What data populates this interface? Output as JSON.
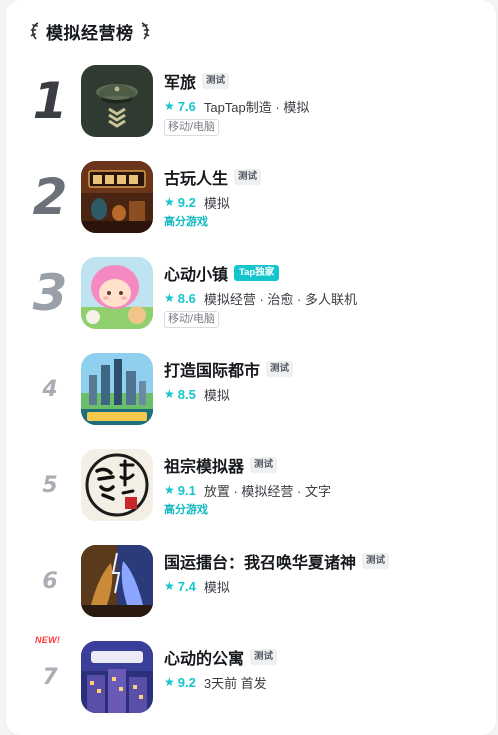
{
  "ranking": {
    "title": "模拟经营榜",
    "items": [
      {
        "rank": "1",
        "name": "军旅",
        "tag": "测试",
        "score": "7.6",
        "categories": "TapTap制造 · 模拟",
        "badge": "移动/电脑",
        "icon": "military-cap-icon"
      },
      {
        "rank": "2",
        "name": "古玩人生",
        "tag": "测试",
        "score": "9.2",
        "categories": "模拟",
        "badge": "高分游戏",
        "icon": "antique-shop-icon"
      },
      {
        "rank": "3",
        "name": "心动小镇",
        "tag": "Tap独家",
        "score": "8.6",
        "categories": "模拟经营 · 治愈 · 多人联机",
        "badge": "移动/电脑",
        "icon": "cute-girl-icon"
      },
      {
        "rank": "4",
        "name": "打造国际都市",
        "tag": "测试",
        "score": "8.5",
        "categories": "模拟",
        "badge": "",
        "icon": "city-skyline-icon"
      },
      {
        "rank": "5",
        "name": "祖宗模拟器",
        "tag": "测试",
        "score": "9.1",
        "categories": "放置 · 模拟经营 · 文字",
        "badge": "高分游戏",
        "icon": "calligraphy-seal-icon"
      },
      {
        "rank": "6",
        "name": "国运擂台：我召唤华夏诸神",
        "tag": "测试",
        "score": "7.4",
        "categories": "模拟",
        "badge": "",
        "icon": "deity-battle-icon"
      },
      {
        "rank": "7",
        "new_label": "NEW!",
        "name": "心动的公寓",
        "tag": "测试",
        "score": "9.2",
        "categories": "3天前 首发",
        "badge": "",
        "icon": "apartment-night-icon"
      }
    ]
  },
  "colors": {
    "accent": "#15c5ce",
    "tag_bg": "#eef0f2"
  }
}
